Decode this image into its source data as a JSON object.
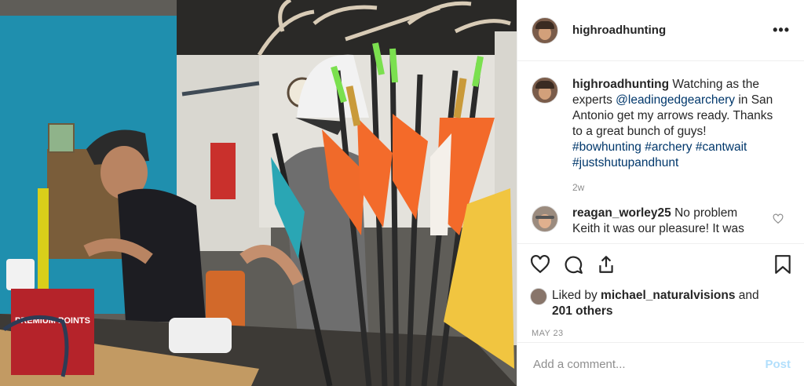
{
  "post": {
    "author": "highroadhunting",
    "more_label": "•••",
    "caption": {
      "username": "highroadhunting",
      "text_1": " Watching as the experts ",
      "mention": "@leadingedgearchery",
      "text_2": " in San Antonio get my arrows ready. Thanks to a great bunch of guys! ",
      "hashtags": [
        "#bowhunting",
        "#archery",
        "#cantwait",
        "#justshutupandhunt"
      ],
      "time": "2w"
    },
    "reply": {
      "username": "reagan_worley25",
      "text": " No problem Keith it was our pleasure! It was"
    },
    "likes": {
      "prefix": "Liked by ",
      "user": "michael_naturalvisions",
      "mid": " and",
      "others": "201 others"
    },
    "date": "MAY 23",
    "add_comment_placeholder": "Add a comment...",
    "post_button": "Post"
  },
  "photo": {
    "sign_line1": "PREMIUM POINTS"
  },
  "icons": [
    "heart-icon",
    "comment-icon",
    "share-icon",
    "bookmark-icon",
    "more-icon"
  ]
}
